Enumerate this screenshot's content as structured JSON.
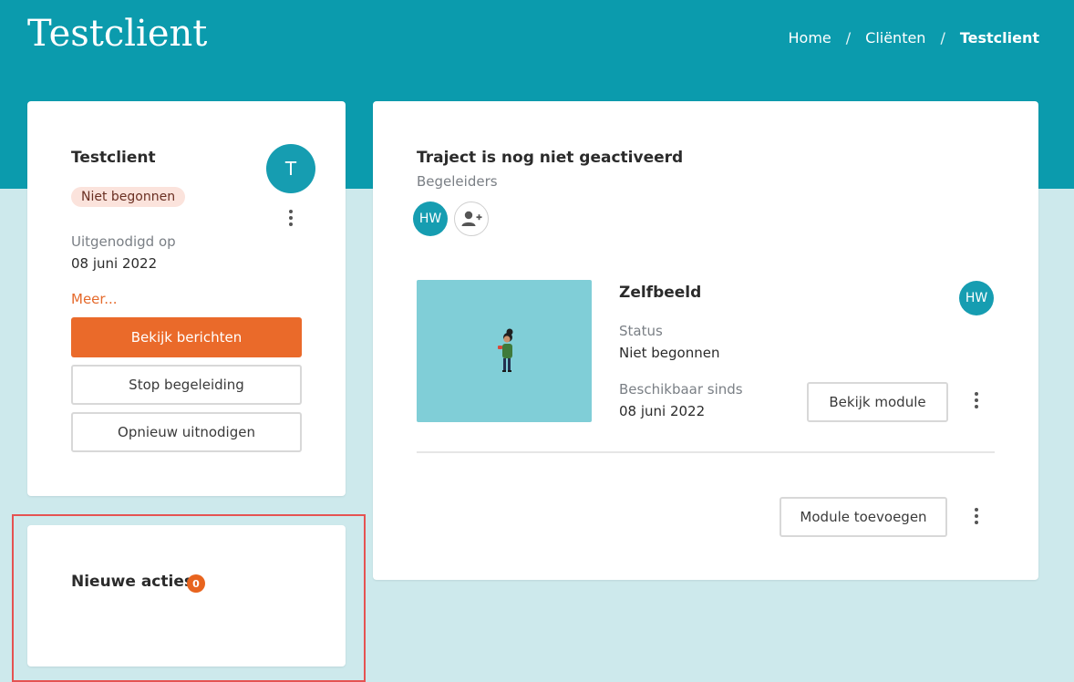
{
  "header": {
    "title": "Testclient",
    "breadcrumb": [
      {
        "label": "Home"
      },
      {
        "label": "Cliënten"
      },
      {
        "label": "Testclient"
      }
    ],
    "separator": "/"
  },
  "client_card": {
    "name": "Testclient",
    "status": "Niet begonnen",
    "avatar_initial": "T",
    "invited_label": "Uitgenodigd op",
    "invited_date": "08 juni 2022",
    "more_link": "Meer...",
    "view_messages_button": "Bekijk berichten",
    "stop_button": "Stop begeleiding",
    "reinvite_button": "Opnieuw uitnodigen"
  },
  "actions_card": {
    "title": "Nieuwe acties",
    "count": "0"
  },
  "traject_card": {
    "title": "Traject is nog niet geactiveerd",
    "guides_label": "Begeleiders",
    "guide_initials": "HW",
    "module": {
      "title": "Zelfbeeld",
      "status_label": "Status",
      "status_value": "Niet begonnen",
      "available_label": "Beschikbaar sinds",
      "available_value": "08 juni 2022",
      "assignee_initials": "HW",
      "view_button": "Bekijk module"
    },
    "add_module_button": "Module toevoegen"
  },
  "colors": {
    "header": "#0b9bad",
    "background": "#cde9ec",
    "accent_orange": "#ea6a2a",
    "avatar_teal": "#169db1",
    "thumb_teal": "#80ced7",
    "highlight_red": "#e55352"
  },
  "icons": [
    "more-vertical-icon",
    "add-user-icon",
    "module-illustration"
  ]
}
